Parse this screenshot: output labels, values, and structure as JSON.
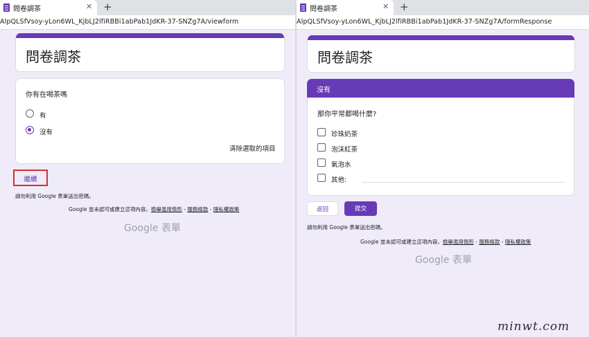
{
  "left": {
    "tab_title": "問卷調茶",
    "tab_close": "✕",
    "tab_new": "+",
    "url": "AlpQLSfVsoy-yLon6WL_KjbLJ2lfiRBBi1abPab1JdKR-37-SNZg7A/viewform",
    "form_title": "問卷調茶",
    "question": "你有在喝茶嗎",
    "options": [
      {
        "label": "有",
        "checked": false
      },
      {
        "label": "沒有",
        "checked": true
      }
    ],
    "clear_label": "清除選取的項目",
    "continue_label": "繼續",
    "note": "請勿利用 Google 表單送出密碼。",
    "disclaimer_prefix": "Google 並未認可或建立這項內容。",
    "link_abuse": "檢舉濫用情形",
    "sep": " - ",
    "link_terms": "服務條款",
    "link_privacy": "隱私權政策",
    "brand": "Google 表單"
  },
  "right": {
    "tab_title": "問卷調茶",
    "tab_close": "✕",
    "tab_new": "+",
    "url": "AlpQLSfVsoy-yLon6WL_KjbLJ2lfiRBBi1abPab1JdKR-37-SNZg7A/formResponse",
    "form_title": "問卷調茶",
    "section_title": "沒有",
    "question": "那你平常都喝什麼?",
    "options": [
      {
        "label": "珍珠奶茶"
      },
      {
        "label": "泡沫紅茶"
      },
      {
        "label": "氣泡水"
      },
      {
        "label": "其他:"
      }
    ],
    "back_label": "返回",
    "submit_label": "提交",
    "note": "請勿利用 Google 表單送出密碼。",
    "disclaimer_prefix": "Google 並未認可或建立這項內容。",
    "link_abuse": "檢舉濫用情形",
    "sep": " - ",
    "link_terms": "服務條款",
    "link_privacy": "隱私權政策",
    "brand": "Google 表單"
  },
  "watermark": "minwt.com",
  "colors": {
    "accent": "#673ab7",
    "background": "#f0ebf8",
    "highlight": "#d32f2f"
  }
}
